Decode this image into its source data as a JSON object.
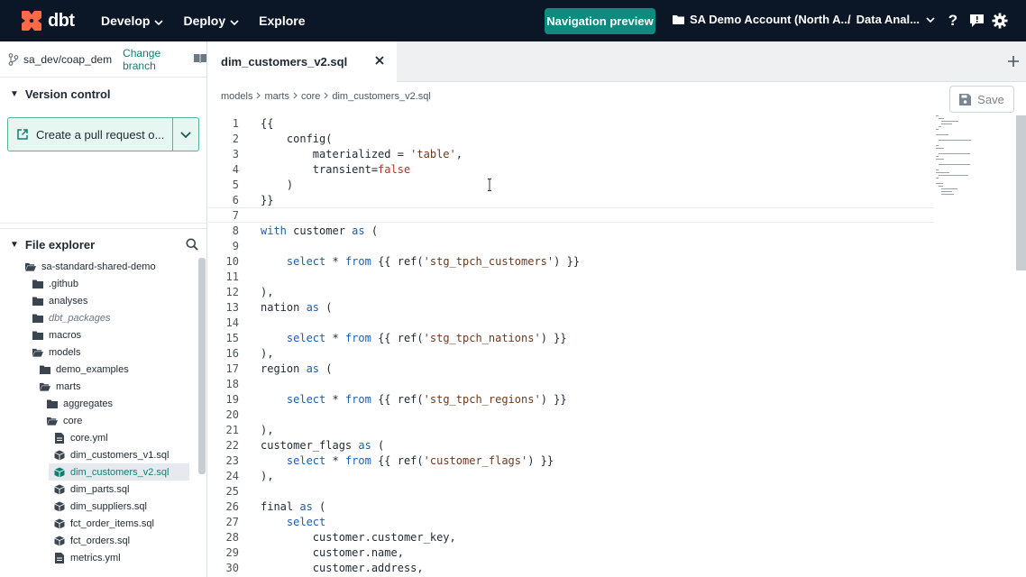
{
  "nav": {
    "logo_text": "dbt",
    "develop": "Develop",
    "deploy": "Deploy",
    "explore": "Explore",
    "preview": "Navigation preview",
    "account": "SA Demo Account (North A...",
    "project_sep": "/",
    "project": "Data Anal...",
    "help_glyph": "?"
  },
  "colors": {
    "nav_bg": "#0b1726",
    "accent": "#0f8a7f",
    "logo": "#ff694a"
  },
  "sidebar": {
    "branch": "sa_dev/coap_dem",
    "change_branch": "Change branch",
    "version_control": "Version control",
    "pr_button": "Create a pull request o...",
    "file_explorer": "File explorer",
    "tree": [
      {
        "label": "sa-standard-shared-demo",
        "indent": 0,
        "kind": "folder-open"
      },
      {
        "label": ".github",
        "indent": 1,
        "kind": "folder"
      },
      {
        "label": "analyses",
        "indent": 1,
        "kind": "folder"
      },
      {
        "label": "dbt_packages",
        "indent": 1,
        "kind": "folder",
        "italic": true
      },
      {
        "label": "macros",
        "indent": 1,
        "kind": "folder"
      },
      {
        "label": "models",
        "indent": 1,
        "kind": "folder-open"
      },
      {
        "label": "demo_examples",
        "indent": 2,
        "kind": "folder"
      },
      {
        "label": "marts",
        "indent": 2,
        "kind": "folder-open"
      },
      {
        "label": "aggregates",
        "indent": 3,
        "kind": "folder"
      },
      {
        "label": "core",
        "indent": 3,
        "kind": "folder-open"
      },
      {
        "label": "core.yml",
        "indent": 4,
        "kind": "file"
      },
      {
        "label": "dim_customers_v1.sql",
        "indent": 4,
        "kind": "model"
      },
      {
        "label": "dim_customers_v2.sql",
        "indent": 4,
        "kind": "model",
        "selected": true
      },
      {
        "label": "dim_parts.sql",
        "indent": 4,
        "kind": "model"
      },
      {
        "label": "dim_suppliers.sql",
        "indent": 4,
        "kind": "model"
      },
      {
        "label": "fct_order_items.sql",
        "indent": 4,
        "kind": "model"
      },
      {
        "label": "fct_orders.sql",
        "indent": 4,
        "kind": "model"
      },
      {
        "label": "metrics.yml",
        "indent": 4,
        "kind": "file"
      }
    ]
  },
  "editor": {
    "tab_title": "dim_customers_v2.sql",
    "breadcrumb": [
      "models",
      "marts",
      "core",
      "dim_customers_v2.sql"
    ],
    "save_label": "Save",
    "lines": [
      [
        {
          "t": "{{",
          "c": "op"
        }
      ],
      [
        {
          "t": "    config(",
          "c": "op"
        }
      ],
      [
        {
          "t": "        materialized = ",
          "c": "op"
        },
        {
          "t": "'table'",
          "c": "st"
        },
        {
          "t": ",",
          "c": "op"
        }
      ],
      [
        {
          "t": "        transient=",
          "c": "op"
        },
        {
          "t": "false",
          "c": "bl"
        }
      ],
      [
        {
          "t": "    )",
          "c": "op"
        }
      ],
      [
        {
          "t": "}}",
          "c": "op"
        }
      ],
      [],
      [
        {
          "t": "with ",
          "c": "kw"
        },
        {
          "t": "customer ",
          "c": "op"
        },
        {
          "t": "as",
          "c": "kw"
        },
        {
          "t": " (",
          "c": "op"
        }
      ],
      [],
      [
        {
          "t": "    select ",
          "c": "kw"
        },
        {
          "t": "* ",
          "c": "op"
        },
        {
          "t": "from ",
          "c": "kw"
        },
        {
          "t": "{{ ref(",
          "c": "op"
        },
        {
          "t": "'stg_tpch_customers'",
          "c": "st"
        },
        {
          "t": ") }}",
          "c": "op"
        }
      ],
      [],
      [
        {
          "t": "),",
          "c": "op"
        }
      ],
      [
        {
          "t": "nation ",
          "c": "op"
        },
        {
          "t": "as",
          "c": "kw"
        },
        {
          "t": " (",
          "c": "op"
        }
      ],
      [],
      [
        {
          "t": "    select ",
          "c": "kw"
        },
        {
          "t": "* ",
          "c": "op"
        },
        {
          "t": "from ",
          "c": "kw"
        },
        {
          "t": "{{ ref(",
          "c": "op"
        },
        {
          "t": "'stg_tpch_nations'",
          "c": "st"
        },
        {
          "t": ") }}",
          "c": "op"
        }
      ],
      [
        {
          "t": "),",
          "c": "op"
        }
      ],
      [
        {
          "t": "region ",
          "c": "op"
        },
        {
          "t": "as",
          "c": "kw"
        },
        {
          "t": " (",
          "c": "op"
        }
      ],
      [],
      [
        {
          "t": "    select ",
          "c": "kw"
        },
        {
          "t": "* ",
          "c": "op"
        },
        {
          "t": "from ",
          "c": "kw"
        },
        {
          "t": "{{ ref(",
          "c": "op"
        },
        {
          "t": "'stg_tpch_regions'",
          "c": "st"
        },
        {
          "t": ") }}",
          "c": "op"
        }
      ],
      [],
      [
        {
          "t": "),",
          "c": "op"
        }
      ],
      [
        {
          "t": "customer_flags ",
          "c": "op"
        },
        {
          "t": "as",
          "c": "kw"
        },
        {
          "t": " (",
          "c": "op"
        }
      ],
      [
        {
          "t": "    select ",
          "c": "kw"
        },
        {
          "t": "* ",
          "c": "op"
        },
        {
          "t": "from ",
          "c": "kw"
        },
        {
          "t": "{{ ref(",
          "c": "op"
        },
        {
          "t": "'customer_flags'",
          "c": "st"
        },
        {
          "t": ") }}",
          "c": "op"
        }
      ],
      [
        {
          "t": "),",
          "c": "op"
        }
      ],
      [],
      [
        {
          "t": "final ",
          "c": "op"
        },
        {
          "t": "as",
          "c": "kw"
        },
        {
          "t": " (",
          "c": "op"
        }
      ],
      [
        {
          "t": "    select",
          "c": "kw"
        }
      ],
      [
        {
          "t": "        customer.customer_key,",
          "c": "op"
        }
      ],
      [
        {
          "t": "        customer.name,",
          "c": "op"
        }
      ],
      [
        {
          "t": "        customer.address,",
          "c": "op"
        }
      ]
    ]
  }
}
